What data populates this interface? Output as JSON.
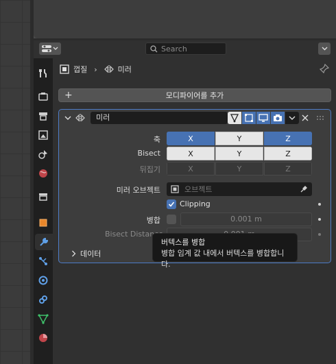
{
  "header": {
    "search_placeholder": "Search"
  },
  "breadcrumb": {
    "object": "껍질",
    "modifier": "미러"
  },
  "add_modifier_label": "모디파이어를 추가",
  "modifier": {
    "name": "미러",
    "rows": {
      "axis_label": "축",
      "bisect_label": "Bisect",
      "flip_label": "뒤집기",
      "axis_labels": [
        "X",
        "Y",
        "Z"
      ],
      "mirror_object_label": "미러 오브젝트",
      "mirror_object_placeholder": "오브젝트",
      "clipping_label": "Clipping",
      "merge_label": "병합",
      "merge_value": "0.001 m",
      "bisect_distance_label": "Bisect Distance",
      "bisect_distance_value": "0.001 m",
      "data_label": "데이터"
    }
  },
  "tooltip": {
    "title": "버텍스를 병합",
    "description": "병합 임계 값 내에서 버텍스를 병합합니다."
  },
  "colors": {
    "accent": "#4772b3",
    "panel_outline": "#4d7cc8"
  }
}
